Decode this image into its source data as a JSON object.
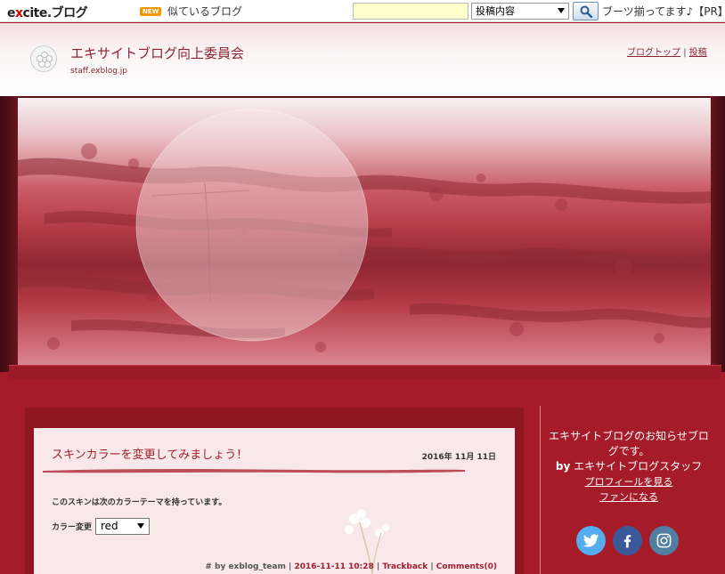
{
  "topbar": {
    "logo_left": "e",
    "logo_x": "x",
    "logo_right": "cite.ブログ",
    "new_badge": "NEW",
    "similar_blogs": "似ているブログ",
    "search_placeholder": "",
    "search_scope": "投稿内容",
    "pr_text": "ブーツ揃ってます♪【PR】"
  },
  "header": {
    "title": "エキサイトブログ向上委員会",
    "url": "staff.exblog.jp",
    "link_top": "ブログトップ",
    "separator": "|",
    "link_post": "投稿"
  },
  "post": {
    "title": "スキンカラーを変更してみましょう！",
    "date": "2016年 11月 11日",
    "body": "このスキンは次のカラーテーマを持っています。",
    "color_label": "カラー変更",
    "color_value": "red",
    "footer": {
      "hash": "#",
      "by": "by exblog_team",
      "sep1": "|",
      "datetime": "2016-11-11 10:28",
      "sep2": "|",
      "trackback": "Trackback",
      "sep3": "|",
      "comments": "Comments(0)"
    }
  },
  "sidebar": {
    "description": "エキサイトブログのお知らせブログです。",
    "by_prefix": "by",
    "by_name": "エキサイトブログスタッフ",
    "profile_link": "プロフィールを見る",
    "fan_link": "ファンになる",
    "social": [
      "twitter-icon",
      "facebook-icon",
      "instagram-icon"
    ]
  },
  "colors": {
    "theme_red": "#a61b28",
    "title_red": "#a1202c",
    "twitter": "#55acee",
    "facebook": "#3b5998",
    "instagram": "#517fa4"
  }
}
